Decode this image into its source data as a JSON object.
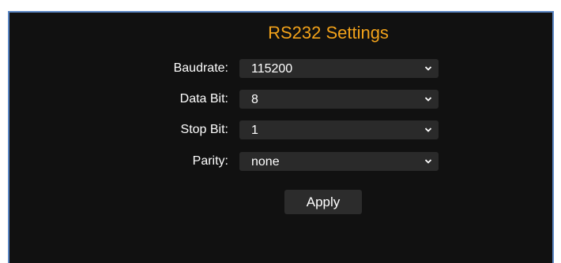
{
  "title": "RS232 Settings",
  "fields": [
    {
      "label": "Baudrate:",
      "value": "115200"
    },
    {
      "label": "Data Bit:",
      "value": "8"
    },
    {
      "label": "Stop Bit:",
      "value": "1"
    },
    {
      "label": "Parity:",
      "value": "none"
    }
  ],
  "apply_label": "Apply",
  "colors": {
    "title": "#f2a21a",
    "panel_bg": "#111111",
    "panel_border": "#5b86c4",
    "control_bg": "#2a2a2a"
  },
  "icons": {
    "dropdown": "chevron-down-icon"
  }
}
